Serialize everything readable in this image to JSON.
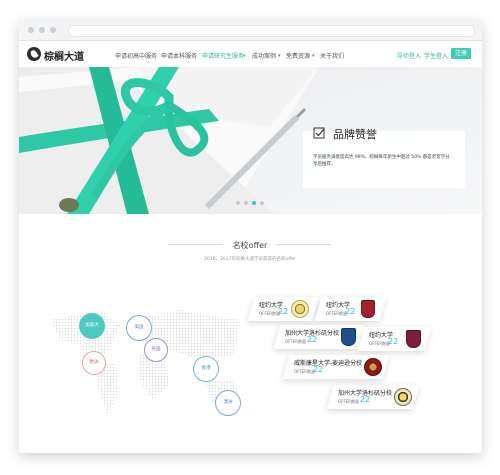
{
  "brand": {
    "name": "棕榈大道"
  },
  "nav": {
    "items": [
      "申请初高中服务",
      "申请本科服务",
      "申请研究生服务",
      "成功案例",
      "免费资源",
      "关于我们"
    ],
    "active_index": 2,
    "teacher_login": "导师登入",
    "student_login": "学生登入",
    "register": "注册"
  },
  "hero": {
    "title": "品牌赞誉",
    "description": "学员服务满意度高达 99%，棕榈每年新生中超过 50% 都是老客学分享后推荐。",
    "carousel_count": 4,
    "carousel_active": 3
  },
  "offers": {
    "title": "名校offer",
    "subtitle": "2016、2017年棕榈大道学员获得的名校offer",
    "regions": [
      "加拿大",
      "美国",
      "英国",
      "欧洲",
      "香港",
      "澳洲"
    ],
    "universities": [
      {
        "name": "纽约大学",
        "label": "OFFER数量",
        "count": "22"
      },
      {
        "name": "纽约大学",
        "label": "OFFER数量",
        "count": "22"
      },
      {
        "name": "加州大学洛杉矶分校",
        "label": "OFFER数量",
        "count": "22"
      },
      {
        "name": "纽约大学",
        "label": "OFFER数量",
        "count": "22"
      },
      {
        "name": "威斯康星大学-麦迪逊分校",
        "label": "OFFER数量",
        "count": "22"
      },
      {
        "name": "加州大学洛杉矶分校",
        "label": "OFFER数量",
        "count": "22"
      }
    ]
  },
  "colors": {
    "accent": "#3dcdb0",
    "ribbon": "#2ec9a4",
    "number": "#35b7e0"
  }
}
